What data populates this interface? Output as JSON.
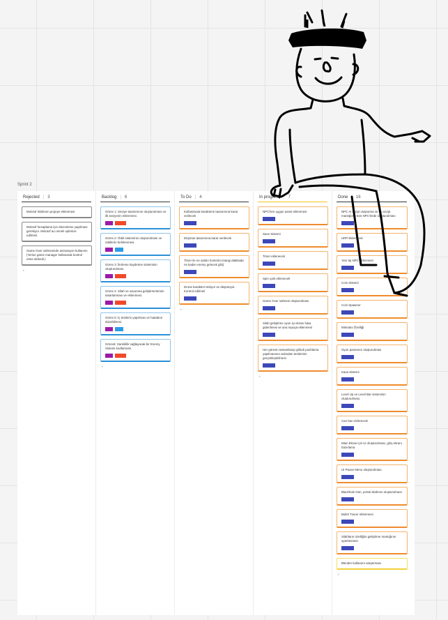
{
  "sprint": {
    "label": "Sprint 2"
  },
  "colors": {
    "indigo": "#3d48b8",
    "purple": "#9c1aa8",
    "red": "#f04a2a",
    "sky": "#2d9be8"
  },
  "icons": {
    "add": "plus-icon"
  },
  "add_symbol": "+",
  "columns": [
    {
      "title": "Rejected",
      "count": "3",
      "style": "grey",
      "cards": [
        {
          "text": "Molotof Silahının projeye eklenmesi",
          "tags": []
        },
        {
          "text": "Molotof hesaplama için düzenleme yapılması gerekiyor. Molotof acı ismeli optimize edilmeli.",
          "tags": []
        },
        {
          "text": "Game Over sahnesinde animasyon kullanımı (Yerine game manager kullanarak kontrol etme eklendi.)",
          "tags": []
        }
      ]
    },
    {
      "title": "Backlog",
      "count": "6",
      "style": "blue",
      "cards": [
        {
          "text": "Görev 1: Seviye tasarımının oluşturulması ve ilk seviyenin eklenmesi.",
          "tags": [
            "purple",
            "red"
          ]
        },
        {
          "text": "Görev 2: Ödül sisteminin oluşturulması ve ödüllerin belirlenmesi.",
          "tags": [
            "purple",
            "sky"
          ]
        },
        {
          "text": "Görev 3: İlerleme kaydetme sisteminin oluşturulması.",
          "tags": [
            "purple",
            "red"
          ]
        },
        {
          "text": "Görev 4: Silah ve savunma geliştirmelerinin tasarlanması ve eklenmesi.",
          "tags": [
            "purple",
            "red"
          ]
        },
        {
          "text": "Görev 5: İç testlerin yapılması ve hataların düzeltilmesi.",
          "tags": [
            "purple",
            "sky"
          ]
        },
        {
          "text": "Görev6: Süreklilik sağlayacak bir Enemy Sistemi kodlanmalı.",
          "tags": [
            "purple",
            "red"
          ]
        }
      ]
    },
    {
      "title": "To Do",
      "count": "4",
      "style": "orange",
      "cards": [
        {
          "text": "Kullanılacak karakterin tasarımına karar verilecek",
          "tags": [
            "indigo"
          ]
        },
        {
          "text": "Düşman tasarımına karar verilecek",
          "tags": [
            "indigo"
          ]
        },
        {
          "text": "Timer ile ne saldırı kontrolü (Hangi dakikada ne kadar enemy gelecek gibi)",
          "tags": [
            "indigo"
          ]
        },
        {
          "text": "Drone karakteri istiriyor ve düşünüyor. Kontrol edilmeli",
          "tags": [
            "indigo"
          ]
        }
      ]
    },
    {
      "title": "In progress",
      "count": "7",
      "style": "orange",
      "cards": [
        {
          "text": "NPC'lere uygun asset eklenmesi",
          "tags": [
            "indigo"
          ]
        },
        {
          "text": "Save Sistemi",
          "tags": [
            "indigo"
          ]
        },
        {
          "text": "Timer eklenecek",
          "tags": [
            "indigo"
          ]
        },
        {
          "text": "Spin çark eklenecek",
          "tags": [
            "indigo"
          ]
        },
        {
          "text": "Game Over sahnesi oluşturulması",
          "tags": [
            "indigo"
          ]
        },
        {
          "text": "Silah geliştirme oyun içi ekranı hata giderilmesi ve ana repoya eklenmesi",
          "tags": [
            "indigo"
          ]
        },
        {
          "text": "Her görevin tamamlanıp github pushlama yapılmasının ardından testlerinin gerçekleştirilmesi",
          "tags": [
            "indigo"
          ]
        }
      ]
    },
    {
      "title": "Done",
      "count": "16",
      "style": "orange",
      "cards": [
        {
          "text": "NPC AI script oluşturma ve bu script mantığının tüm NPC'lerde oluşturulması",
          "tags": [
            "indigo"
          ]
        },
        {
          "text": "URP Eklenecek",
          "tags": [
            "indigo"
          ]
        },
        {
          "text": "Yeni tip NPC eklenmesi",
          "tags": [
            "indigo"
          ]
        },
        {
          "text": "Coin Sistemi",
          "tags": [
            "indigo"
          ]
        },
        {
          "text": "Coin Spawner",
          "tags": [
            "indigo"
          ]
        },
        {
          "text": "Mıknatıs Özelliği",
          "tags": [
            "indigo"
          ]
        },
        {
          "text": "Oyun parasının oluşturulması",
          "tags": [
            "indigo"
          ]
        },
        {
          "text": "Kasa Sistemi",
          "tags": [
            "indigo"
          ]
        },
        {
          "text": "Level Up ve Level Bar sisteminin oluşturulması.",
          "tags": [
            "indigo"
          ]
        },
        {
          "text": "Can barı eklenecek",
          "tags": [
            "indigo"
          ]
        },
        {
          "text": "Main Ekran için UI oluşturulması, giriş ekranı hazırlama",
          "tags": [
            "indigo"
          ]
        },
        {
          "text": "UI Pause Menu oluşturulması.",
          "tags": [
            "indigo"
          ]
        },
        {
          "text": "Blackhole Gün, portal silahının oluşturulması",
          "tags": [
            "indigo"
          ]
        },
        {
          "text": "Bullet Tracer eklenmesi",
          "tags": [
            "indigo"
          ]
        },
        {
          "text": "Silahların özelliğini geliştirme mantığının ayarlanması",
          "tags": [
            "indigo"
          ]
        },
        {
          "text": "Blender kullanımı araştırması",
          "tags": [],
          "style": "yellow"
        }
      ]
    }
  ]
}
